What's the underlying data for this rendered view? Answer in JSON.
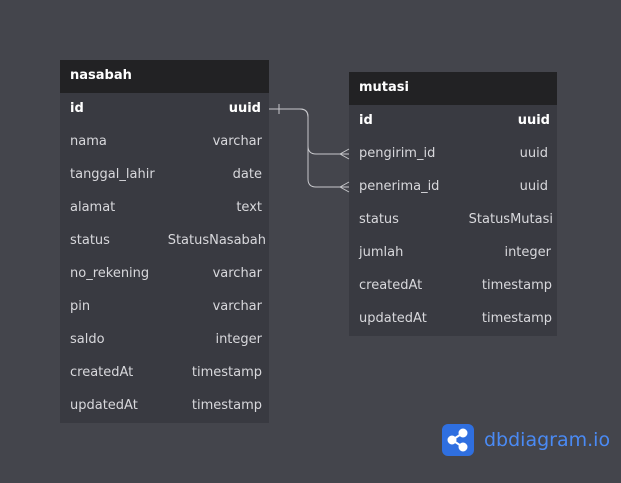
{
  "tables": {
    "nasabah": {
      "name": "nasabah",
      "columns": [
        {
          "name": "id",
          "type": "uuid"
        },
        {
          "name": "nama",
          "type": "varchar"
        },
        {
          "name": "tanggal_lahir",
          "type": "date"
        },
        {
          "name": "alamat",
          "type": "text"
        },
        {
          "name": "status",
          "type": "StatusNasabah"
        },
        {
          "name": "no_rekening",
          "type": "varchar"
        },
        {
          "name": "pin",
          "type": "varchar"
        },
        {
          "name": "saldo",
          "type": "integer"
        },
        {
          "name": "createdAt",
          "type": "timestamp"
        },
        {
          "name": "updatedAt",
          "type": "timestamp"
        }
      ]
    },
    "mutasi": {
      "name": "mutasi",
      "columns": [
        {
          "name": "id",
          "type": "uuid"
        },
        {
          "name": "pengirim_id",
          "type": "uuid"
        },
        {
          "name": "penerima_id",
          "type": "uuid"
        },
        {
          "name": "status",
          "type": "StatusMutasi"
        },
        {
          "name": "jumlah",
          "type": "integer"
        },
        {
          "name": "createdAt",
          "type": "timestamp"
        },
        {
          "name": "updatedAt",
          "type": "timestamp"
        }
      ]
    }
  },
  "brand": {
    "name": "dbdiagram.io",
    "color": "#4a8af4"
  },
  "colors": {
    "background": "#44454c",
    "table_body": "#393a41",
    "table_header": "#222224",
    "connector": "#c8c8cc"
  }
}
